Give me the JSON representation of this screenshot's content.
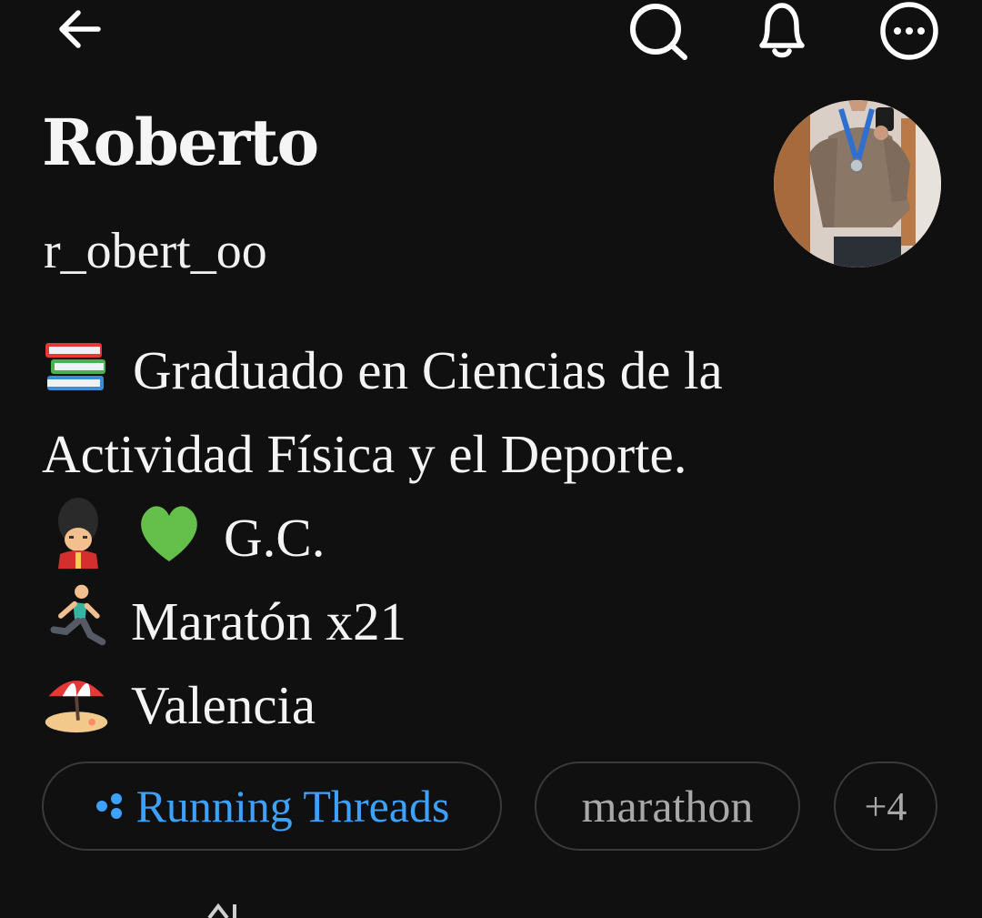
{
  "topbar": {
    "back_icon": "arrow-left-icon",
    "search_icon": "search-icon",
    "notifications_icon": "bell-icon",
    "more_icon": "more-horizontal-circle-icon"
  },
  "profile": {
    "name": "Roberto",
    "handle": "r_obert_oo",
    "avatar_icon": "profile-photo"
  },
  "bio": {
    "lines": [
      {
        "emoji": "books",
        "text": "Graduado en Ciencias de la"
      },
      {
        "emoji": "",
        "text": "Actividad Física y el Deporte."
      },
      {
        "emoji": "guard + green-heart",
        "text": "G.C."
      },
      {
        "emoji": "person-running",
        "text": "Maratón x21"
      },
      {
        "emoji": "beach-with-umbrella",
        "text": "Valencia"
      }
    ]
  },
  "chips": {
    "running": {
      "label": "Running Threads",
      "icon": "threads-dots-icon",
      "color": "#3da2ff"
    },
    "marathon": {
      "label": "marathon"
    },
    "more": {
      "label": "+4"
    }
  },
  "colors": {
    "background": "#101010",
    "text": "#f3f3f3",
    "accent": "#3da2ff",
    "chip_border": "#3a3a3a",
    "chip_text_muted": "#a8a8a8"
  }
}
